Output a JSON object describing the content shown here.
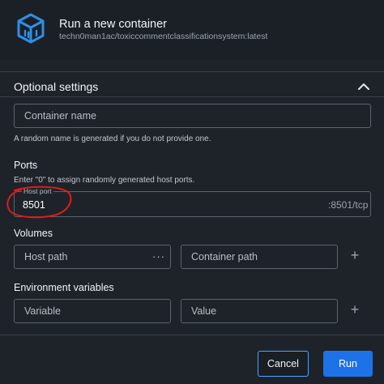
{
  "header": {
    "title": "Run a new container",
    "subtitle": "techn0man1ac/toxiccommentclassificationsystem:latest",
    "logo_icon": "cube-icon"
  },
  "optional": {
    "title": "Optional settings",
    "toggle_icon": "chevron-up-icon"
  },
  "container_name": {
    "placeholder": "Container name",
    "help": "A random name is generated if you do not provide one."
  },
  "ports": {
    "label": "Ports",
    "help": "Enter \"0\" to assign randomly generated host ports.",
    "host_port_label": "Host port",
    "host_port_value": "8501",
    "container_port": ":8501/tcp"
  },
  "volumes": {
    "label": "Volumes",
    "host_path_placeholder": "Host path",
    "browse_icon": "ellipsis-icon",
    "container_path_placeholder": "Container path",
    "add_icon": "plus-icon"
  },
  "env": {
    "label": "Environment variables",
    "variable_placeholder": "Variable",
    "value_placeholder": "Value",
    "add_icon": "plus-icon"
  },
  "actions": {
    "cancel_label": "Cancel",
    "run_label": "Run"
  },
  "colors": {
    "background": "#1e2329",
    "primary": "#1d72e8",
    "annotation": "#e01b1b"
  }
}
